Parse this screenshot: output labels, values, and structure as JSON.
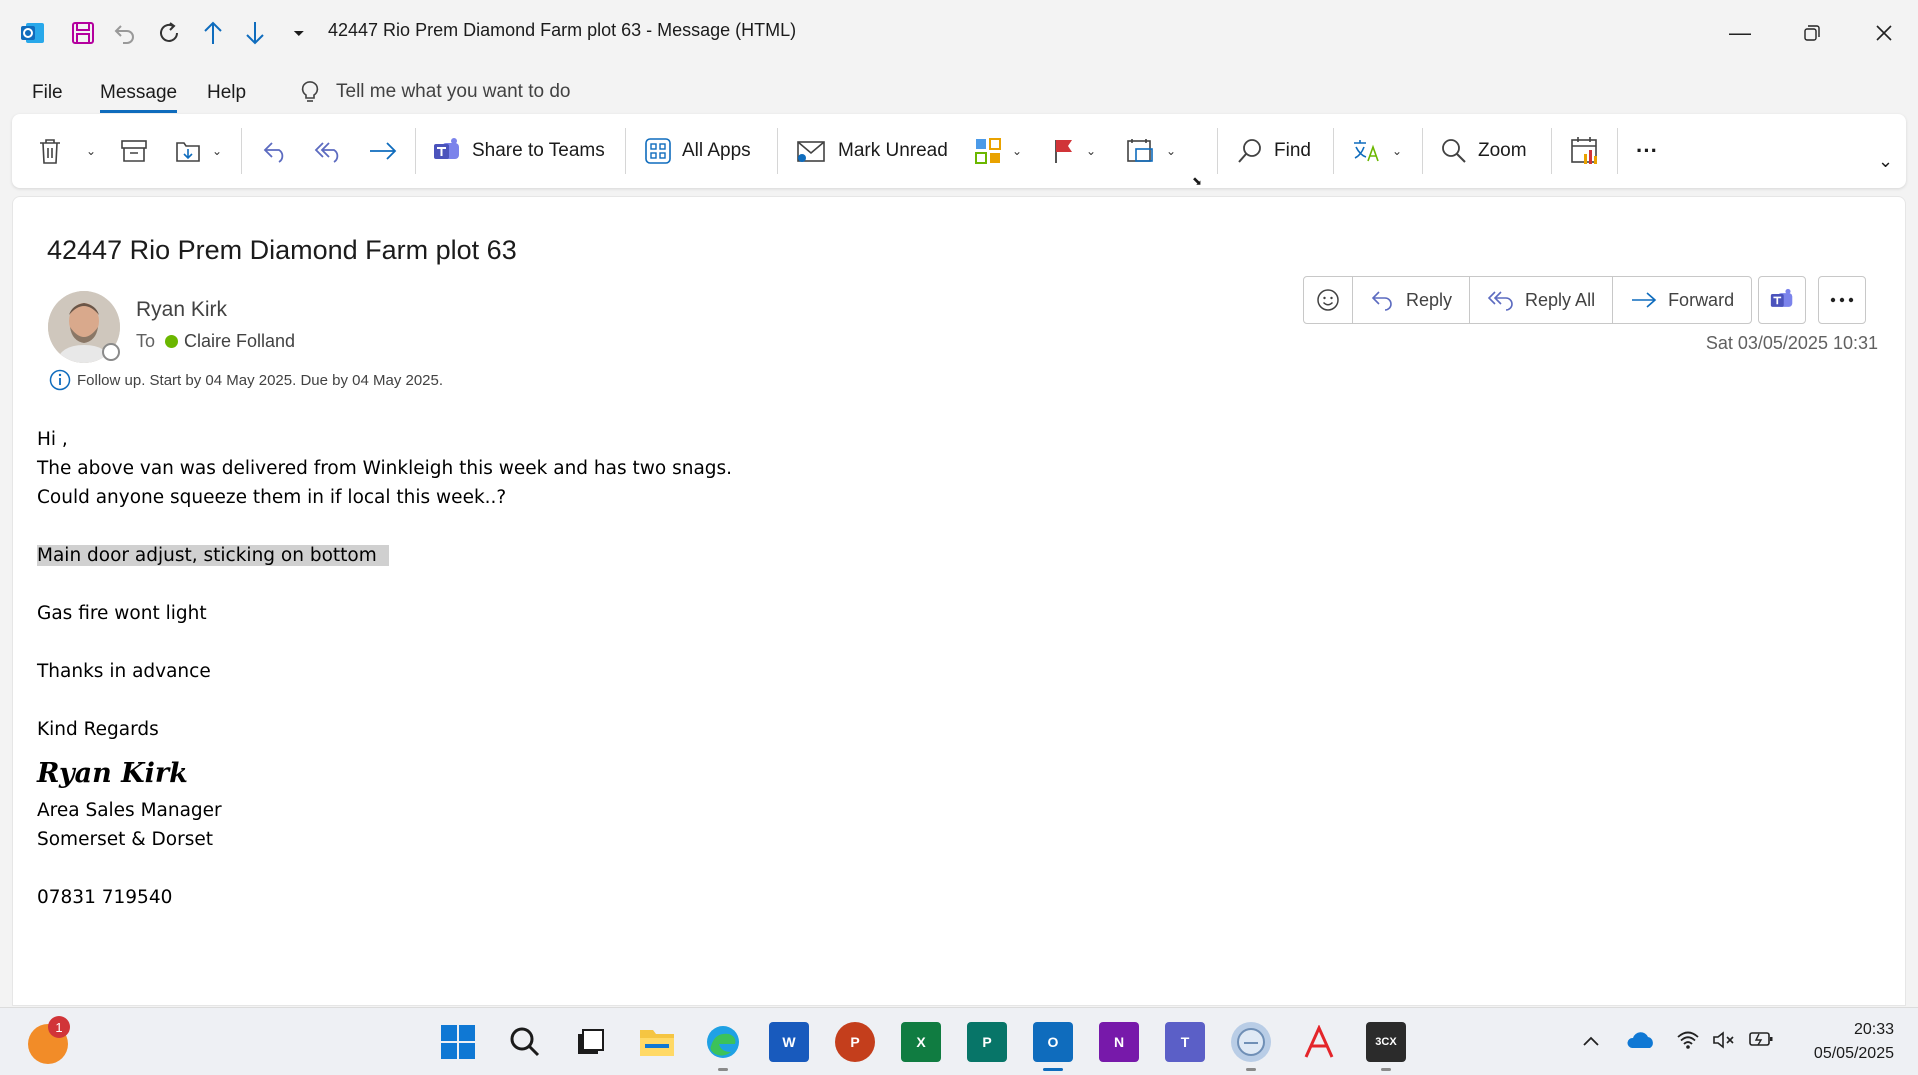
{
  "window": {
    "title": "42447 Rio Prem Diamond Farm plot 63  -  Message (HTML)"
  },
  "menu": {
    "tabs": [
      "File",
      "Message",
      "Help"
    ],
    "tell_me": "Tell me what you want to do"
  },
  "ribbon": {
    "share_teams": "Share to Teams",
    "all_apps": "All Apps",
    "mark_unread": "Mark Unread",
    "find": "Find",
    "zoom": "Zoom",
    "more": "···"
  },
  "message": {
    "subject": "42447 Rio Prem Diamond Farm plot 63",
    "sender": "Ryan Kirk",
    "to_label": "To",
    "recipient": "Claire Folland",
    "followup": "Follow up.  Start by 04 May 2025.  Due by 04 May 2025.",
    "date": "Sat 03/05/2025 10:31",
    "actions": {
      "reply": "Reply",
      "reply_all": "Reply All",
      "forward": "Forward"
    },
    "body": {
      "greeting": "Hi ,",
      "line1": "The above van was delivered from Winkleigh this week and has two snags.",
      "line2": "Could anyone squeeze them in if local this week..?",
      "snag1": "Main door adjust, sticking on bottom",
      "snag2": "Gas fire wont light",
      "thanks": "Thanks in advance",
      "regards": "Kind Regards",
      "signature": "Ryan  Kirk",
      "role": "Area Sales Manager",
      "region": "Somerset & Dorset",
      "phone": "07831 719540"
    }
  },
  "taskbar": {
    "notification_count": "1",
    "time": "20:33",
    "date": "05/05/2025"
  },
  "colors": {
    "accent": "#0f6cbd",
    "presence_available": "#6bb700",
    "highlight": "#d0d0d0"
  }
}
